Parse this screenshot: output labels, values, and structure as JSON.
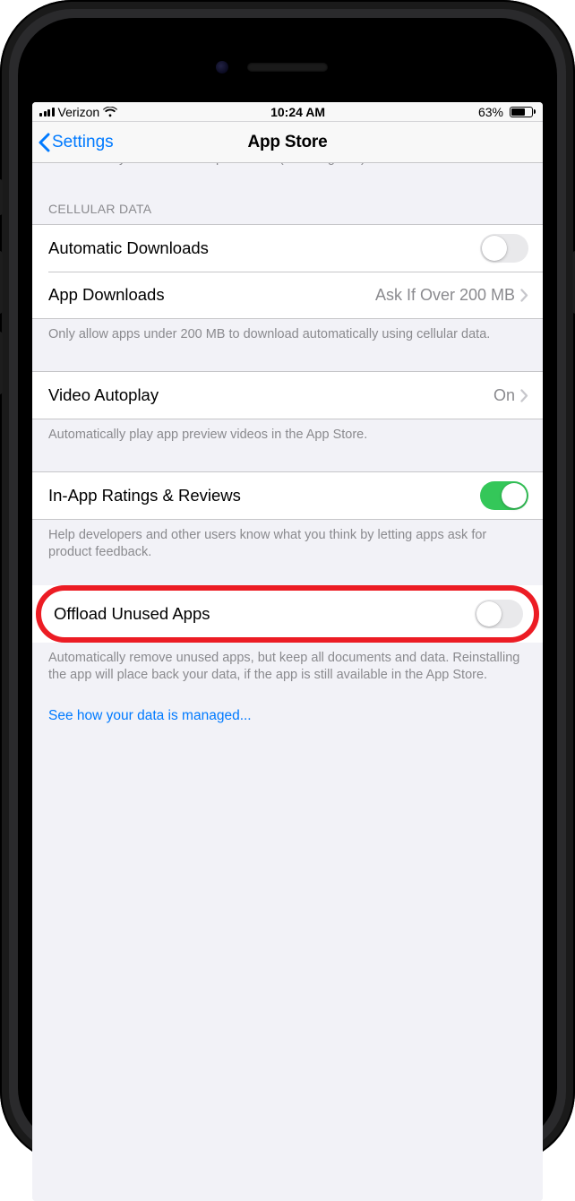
{
  "statusbar": {
    "carrier": "Verizon",
    "time": "10:24 AM",
    "battery_pct": "63%"
  },
  "nav": {
    "back_label": "Settings",
    "title": "App Store"
  },
  "clipped_header_text": "Automatically download new purchases (including free) made on other devices.",
  "sections": {
    "cellular": {
      "header": "Cellular Data",
      "auto_downloads_label": "Automatic Downloads",
      "app_downloads_label": "App Downloads",
      "app_downloads_value": "Ask If Over 200 MB",
      "footer": "Only allow apps under 200 MB to download automatically using cellular data."
    },
    "video": {
      "label": "Video Autoplay",
      "value": "On",
      "footer": "Automatically play app preview videos in the App Store."
    },
    "ratings": {
      "label": "In-App Ratings & Reviews",
      "footer": "Help developers and other users know what you think by letting apps ask for product feedback."
    },
    "offload": {
      "label": "Offload Unused Apps",
      "footer": "Automatically remove unused apps, but keep all documents and data. Reinstalling the app will place back your data, if the app is still available in the App Store."
    }
  },
  "link": "See how your data is managed..."
}
